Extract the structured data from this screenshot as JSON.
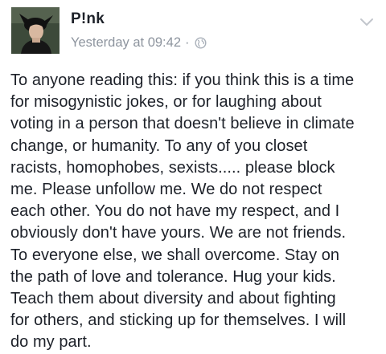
{
  "post": {
    "author_name": "P!nk",
    "timestamp": "Yesterday at 09:42",
    "separator": "·",
    "privacy_icon": "globe-icon",
    "menu_icon": "chevron-down-icon",
    "message_lines": [
      "To anyone reading this: if you think this is a time",
      "for misogynistic jokes, or for laughing about",
      "voting in a person that doesn't believe in climate",
      "change, or humanity. To any of you closet",
      "racists, homophobes, sexists..... please block",
      "me. Please unfollow me. We do not respect",
      "each other. You do not have my respect, and I",
      "obviously don't have yours. We are not friends.",
      "To everyone else, we shall overcome. Stay on",
      "the path of love and tolerance. Hug your kids.",
      "Teach them about diversity and about fighting",
      "for others, and sticking up for themselves. I will",
      "do my part."
    ]
  },
  "colors": {
    "text_primary": "#1d2129",
    "text_secondary": "#8d949e",
    "background": "#ffffff"
  }
}
